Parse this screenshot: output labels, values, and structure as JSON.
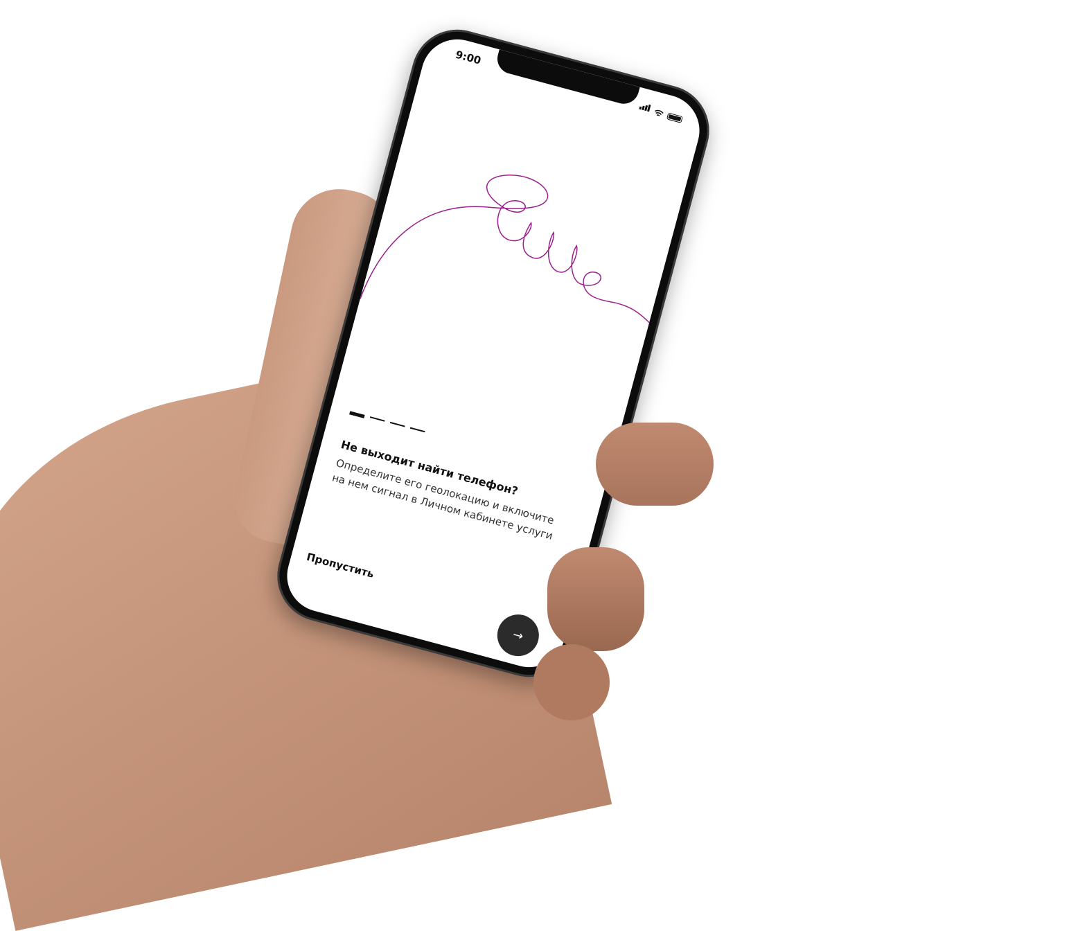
{
  "status_bar": {
    "time": "9:00",
    "icons": [
      "signal-icon",
      "wifi-icon",
      "battery-icon"
    ]
  },
  "illustration": {
    "text": "Hello",
    "color": "#9b1f8c"
  },
  "onboarding": {
    "page_count": 4,
    "current_page": 1,
    "title": "Не выходит найти телефон?",
    "body": "Определите его геолокацию и включите на нем сигнал в Личном кабинете услуги",
    "skip_label": "Пропустить",
    "next_icon": "→"
  }
}
